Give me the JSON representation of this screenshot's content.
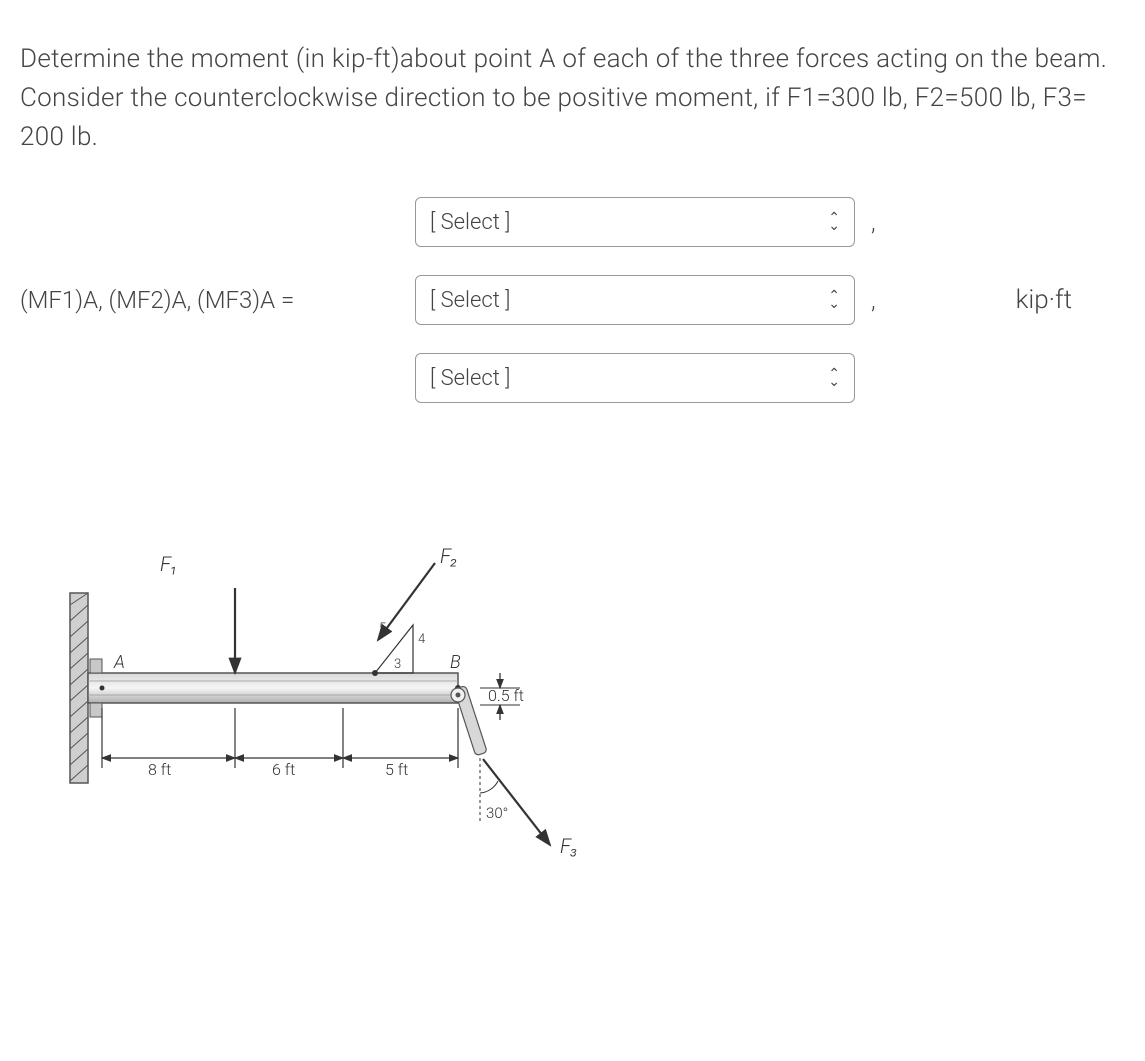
{
  "question": "Determine the moment (in kip-ft)about point A of each of the three forces acting on the beam. Consider the counterclockwise direction to be positive moment, if F1=300 lb, F2=500 lb, F3= 200 lb.",
  "equation_label": "(MF1)A, (MF2)A, (MF3)A =",
  "selects": {
    "s1": {
      "placeholder": "[ Select ]",
      "comma": ","
    },
    "s2": {
      "placeholder": "[ Select ]",
      "comma": ","
    },
    "s3": {
      "placeholder": "[ Select ]",
      "comma": ""
    }
  },
  "unit": "kip·ft",
  "figure": {
    "F1": "F₁",
    "F2": "F₂",
    "F3": "F₃",
    "A": "A",
    "B": "B",
    "d1": "8 ft",
    "d2": "6 ft",
    "d3": "5 ft",
    "d4": "0.5 ft",
    "angle": "30°",
    "tri_top": "4",
    "tri_left": "5",
    "tri_bottom": "3"
  }
}
